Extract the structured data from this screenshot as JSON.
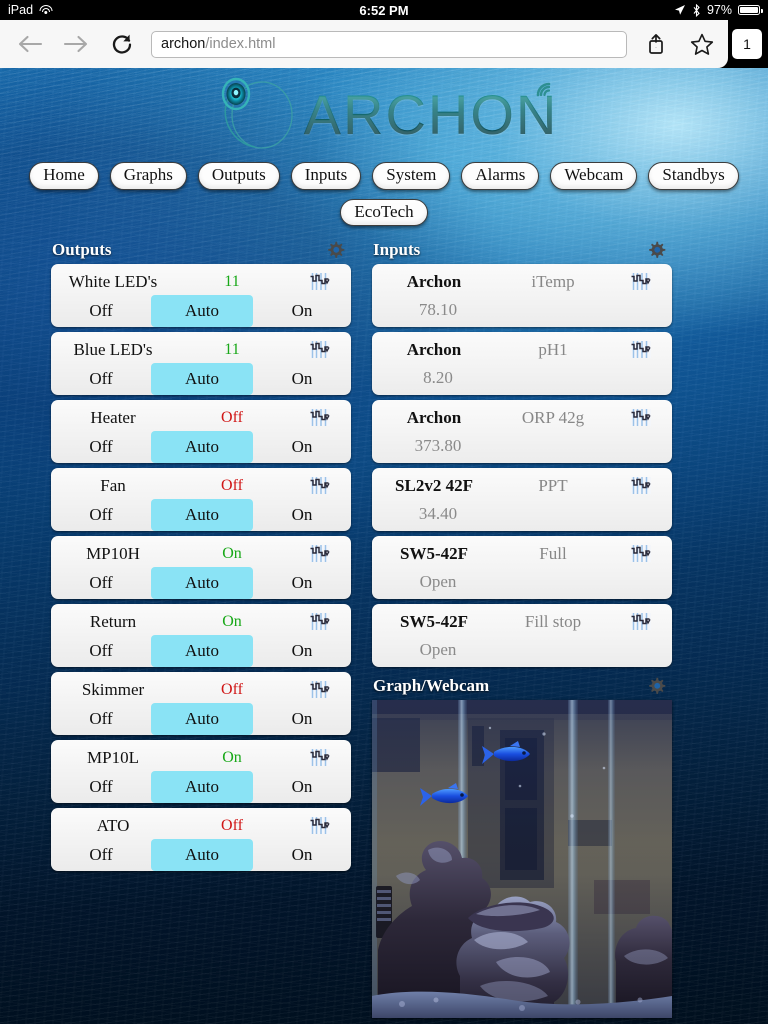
{
  "status_bar": {
    "carrier": "iPad",
    "wifi_icon": "wifi-icon",
    "time": "6:52 PM",
    "location_icon": "location-arrow-icon",
    "bluetooth_icon": "bluetooth-icon",
    "battery_percent": "97%",
    "battery_icon": "battery-icon"
  },
  "browser": {
    "back_icon": "back-arrow-icon",
    "forward_icon": "forward-arrow-icon",
    "reload_icon": "reload-icon",
    "url_host": "archon",
    "url_path": "/index.html",
    "share_icon": "share-icon",
    "bookmark_icon": "star-icon",
    "tab_count": "1"
  },
  "logo": {
    "wordmark": "ARCHON",
    "mark_icon": "archon-swirl-icon",
    "signal_icon": "wireless-signal-icon"
  },
  "nav": {
    "items": [
      {
        "label": "Home"
      },
      {
        "label": "Graphs"
      },
      {
        "label": "Outputs"
      },
      {
        "label": "Inputs"
      },
      {
        "label": "System"
      },
      {
        "label": "Alarms"
      },
      {
        "label": "Webcam"
      },
      {
        "label": "Standbys"
      }
    ],
    "secondary": [
      {
        "label": "EcoTech"
      }
    ]
  },
  "outputs": {
    "title": "Outputs",
    "gear_icon": "gear-icon",
    "graph_icon": "graph-icon",
    "buttons": {
      "off": "Off",
      "auto": "Auto",
      "on": "On"
    },
    "rows": [
      {
        "name": "White LED's",
        "state": "11",
        "state_kind": "num",
        "selected": "Auto"
      },
      {
        "name": "Blue LED's",
        "state": "11",
        "state_kind": "num",
        "selected": "Auto"
      },
      {
        "name": "Heater",
        "state": "Off",
        "state_kind": "off",
        "selected": "Auto"
      },
      {
        "name": "Fan",
        "state": "Off",
        "state_kind": "off",
        "selected": "Auto"
      },
      {
        "name": "MP10H",
        "state": "On",
        "state_kind": "on",
        "selected": "Auto"
      },
      {
        "name": "Return",
        "state": "On",
        "state_kind": "on",
        "selected": "Auto"
      },
      {
        "name": "Skimmer",
        "state": "Off",
        "state_kind": "off",
        "selected": "Auto"
      },
      {
        "name": "MP10L",
        "state": "On",
        "state_kind": "on",
        "selected": "Auto"
      },
      {
        "name": "ATO",
        "state": "Off",
        "state_kind": "off",
        "selected": "Auto"
      }
    ]
  },
  "inputs": {
    "title": "Inputs",
    "gear_icon": "gear-icon",
    "graph_icon": "graph-icon",
    "rows": [
      {
        "device": "Archon",
        "type": "iTemp",
        "value": "78.10"
      },
      {
        "device": "Archon",
        "type": "pH1",
        "value": "8.20"
      },
      {
        "device": "Archon",
        "type": "ORP 42g",
        "value": "373.80"
      },
      {
        "device": "SL2v2 42F",
        "type": "PPT",
        "value": "34.40"
      },
      {
        "device": "SW5-42F",
        "type": "Full",
        "value": "Open"
      },
      {
        "device": "SW5-42F",
        "type": "Fill stop",
        "value": "Open"
      }
    ]
  },
  "graph_webcam": {
    "title": "Graph/Webcam",
    "gear_icon": "gear-icon",
    "image_alt": "aquarium-webcam-feed"
  },
  "colors": {
    "selected_button": "#8ae3f5",
    "state_on": "#18a818",
    "state_off": "#d01616",
    "panel_bg": "#f4f4f4",
    "heading_text": "#ffffff"
  }
}
